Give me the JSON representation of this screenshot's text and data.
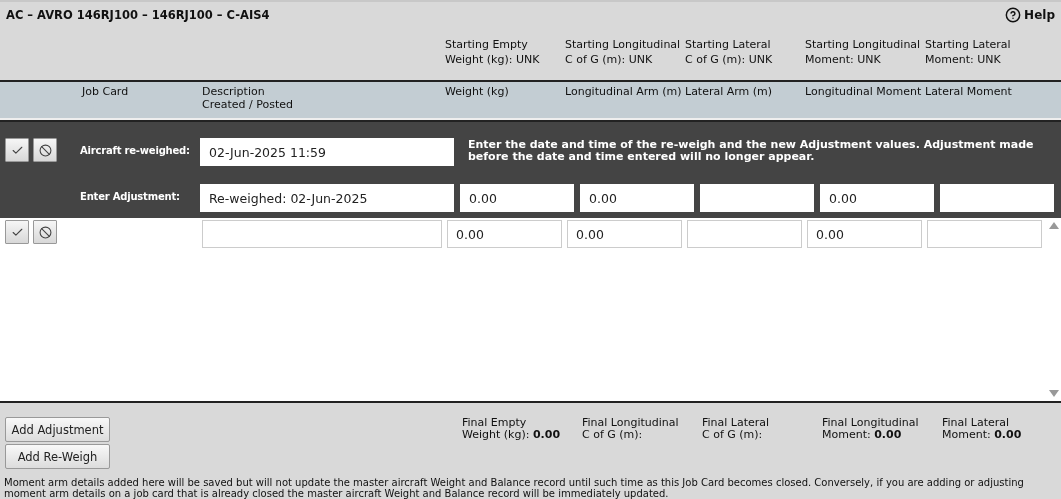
{
  "header": {
    "title": "AC – AVRO 146RJ100 – 146RJ100 – C-AIS4",
    "help": "Help"
  },
  "summary": [
    {
      "lines": [
        "Starting Empty",
        "Weight (kg): UNK"
      ]
    },
    {
      "lines": [
        "Starting Longitudinal",
        "C of G (m): UNK"
      ]
    },
    {
      "lines": [
        "Starting Lateral",
        "C of G (m): UNK"
      ]
    },
    {
      "lines": [
        "Starting Longitudinal",
        "Moment: UNK"
      ]
    },
    {
      "lines": [
        "Starting Lateral",
        "Moment: UNK"
      ]
    }
  ],
  "columns": [
    {
      "lines": [
        "Job Card"
      ]
    },
    {
      "lines": [
        "Description",
        "Created / Posted"
      ]
    },
    {
      "lines": [
        "Weight (kg)"
      ]
    },
    {
      "lines": [
        "Longitudinal Arm (m)"
      ]
    },
    {
      "lines": [
        "Lateral Arm (m)"
      ]
    },
    {
      "lines": [
        "Longitudinal Moment"
      ]
    },
    {
      "lines": [
        "Lateral Moment"
      ]
    }
  ],
  "reweigh": {
    "label": "Aircraft re-weighed:",
    "value": "02-Jun-2025 11:59",
    "note": "Enter the date and time of the re-weigh and the new Adjustment values. Adjustment made before the date and time entered will no longer appear."
  },
  "adjustment": {
    "label": "Enter Adjustment:",
    "description": "Re-weighed: 02-Jun-2025",
    "values": [
      {
        "kind": "filled",
        "value": "0.00"
      },
      {
        "kind": "filled",
        "value": "0.00"
      },
      {
        "kind": "empty"
      },
      {
        "kind": "filled",
        "value": "0.00"
      },
      {
        "kind": "empty"
      }
    ]
  },
  "rows": [
    {
      "values": [
        {
          "kind": "filled",
          "value": "0.00"
        },
        {
          "kind": "filled",
          "value": "0.00"
        },
        {
          "kind": "empty"
        },
        {
          "kind": "filled",
          "value": "0.00"
        },
        {
          "kind": "empty"
        }
      ]
    }
  ],
  "buttons": [
    "Add Adjustment",
    "Add Re-Weigh"
  ],
  "totals": [
    {
      "lines": [
        "Final Empty",
        "Weight (kg):"
      ],
      "value": "0.00"
    },
    {
      "lines": [
        "Final Longitudinal",
        "C of G (m):"
      ]
    },
    {
      "lines": [
        "Final Lateral",
        "C of G (m):"
      ]
    },
    {
      "lines": [
        "Final Longitudinal",
        "Moment:"
      ],
      "value": "0.00"
    },
    {
      "lines": [
        "Final Lateral",
        "Moment:"
      ],
      "value": "0.00"
    }
  ],
  "footnote": "Moment arm details added here will be saved but will not update the master aircraft Weight and Balance record until such time as this Job Card becomes closed. Conversely, if you are adding or adjusting moment arm details on a job card that is already closed the master aircraft Weight and Balance record will be immediately updated."
}
